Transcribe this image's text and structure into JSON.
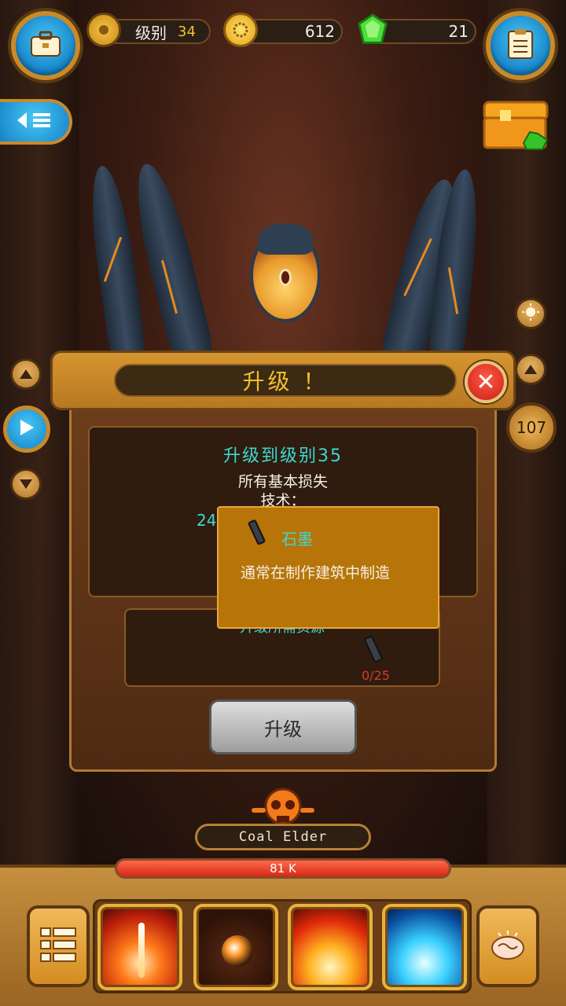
{
  "hud": {
    "level_label": "级别",
    "level_value": "34",
    "gold_value": "612",
    "gems_value": "21",
    "side_counter": "107"
  },
  "dialog": {
    "title": "升级 ！",
    "heading": "升级到级别35",
    "line1": "所有基本损失",
    "line2": "技术：",
    "partial_value": "24",
    "requirement_label": "升级所需资源",
    "resource_count": "0/25",
    "upgrade_button": "升级"
  },
  "tooltip": {
    "item_name": "石墨",
    "description": "通常在制作建筑中制造"
  },
  "boss": {
    "name": "Coal Elder",
    "hp_text": "81 K",
    "hp_fraction": 1.0
  },
  "icons": {
    "top_left": "briefcase-icon",
    "top_right": "clipboard-icon",
    "menu": "list-icon",
    "brain": "brain-icon"
  },
  "colors": {
    "accent_cyan": "#3bd9d0",
    "title_gold": "#f2c02c",
    "hp_red": "#d42a17"
  }
}
